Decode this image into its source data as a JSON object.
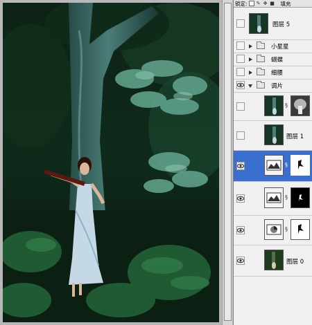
{
  "panel": {
    "toolbar": {
      "lock_label": "锁定:",
      "fill_label": "填充"
    },
    "layers": [
      {
        "name": "图层 5",
        "type": "layer",
        "visible": false,
        "thumb": "photo-small"
      },
      {
        "name": "小星星",
        "type": "group",
        "visible": false,
        "expanded": false
      },
      {
        "name": "蝴蝶",
        "type": "group",
        "visible": false,
        "expanded": false
      },
      {
        "name": "细腰",
        "type": "group",
        "visible": false,
        "expanded": false
      },
      {
        "name": "调片",
        "type": "group",
        "visible": true,
        "expanded": true
      },
      {
        "name": "",
        "type": "masked-layer",
        "visible": false,
        "thumb": "photo-small",
        "mask": "gray-mask"
      },
      {
        "name": "图层 1",
        "type": "layer",
        "visible": false,
        "thumb": "photo-small"
      },
      {
        "name": "",
        "type": "adjustment",
        "visible": true,
        "selected": true,
        "mask": "white-mask"
      },
      {
        "name": "",
        "type": "adjustment",
        "visible": true,
        "mask": "black-mask"
      },
      {
        "name": "",
        "type": "adjustment-circle",
        "visible": true,
        "mask": "white-mask"
      },
      {
        "name": "图层 0",
        "type": "layer",
        "visible": true,
        "thumb": "photo-small"
      }
    ]
  },
  "icons": {
    "eye": "eye-icon",
    "folder": "folder-icon",
    "chain": "chain-link-icon"
  },
  "colors": {
    "selection": "#3a6fd0",
    "panel_bg": "#f0f0f0"
  }
}
